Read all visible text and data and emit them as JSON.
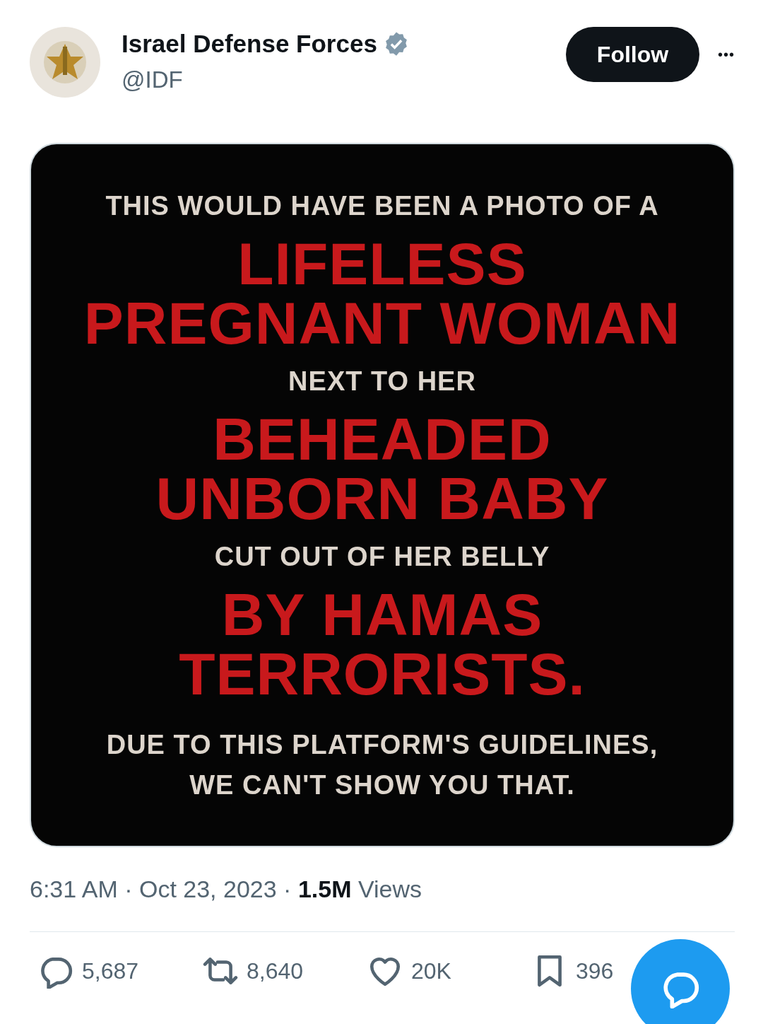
{
  "author": {
    "name": "Israel Defense Forces",
    "handle": "@IDF",
    "verified": true
  },
  "follow_button": "Follow",
  "more_button": "•••",
  "image": {
    "lines": [
      {
        "kind": "caption",
        "text": "THIS WOULD HAVE BEEN A PHOTO  OF A"
      },
      {
        "kind": "headline",
        "text": "LIFELESS"
      },
      {
        "kind": "headline",
        "text": "PREGNANT WOMAN"
      },
      {
        "kind": "caption",
        "text": "NEXT TO HER"
      },
      {
        "kind": "headline",
        "text": "BEHEADED"
      },
      {
        "kind": "headline",
        "text": "UNBORN BABY"
      },
      {
        "kind": "caption",
        "text": "CUT OUT OF HER BELLY"
      },
      {
        "kind": "headline",
        "text": "BY HAMAS"
      },
      {
        "kind": "headline",
        "text": "TERRORISTS."
      },
      {
        "kind": "footer",
        "text": "DUE TO THIS PLATFORM'S GUIDELINES,"
      },
      {
        "kind": "footer",
        "text": "WE CAN'T SHOW YOU THAT."
      }
    ]
  },
  "meta": "6:31 AM · Oct 23, 2023 · **1.5M** Views",
  "actions": [
    {
      "kind": "reply",
      "count": "5,687"
    },
    {
      "kind": "repost",
      "count": "8,640"
    },
    {
      "kind": "like",
      "count": "20K"
    },
    {
      "kind": "bookmark",
      "count": "396"
    }
  ]
}
